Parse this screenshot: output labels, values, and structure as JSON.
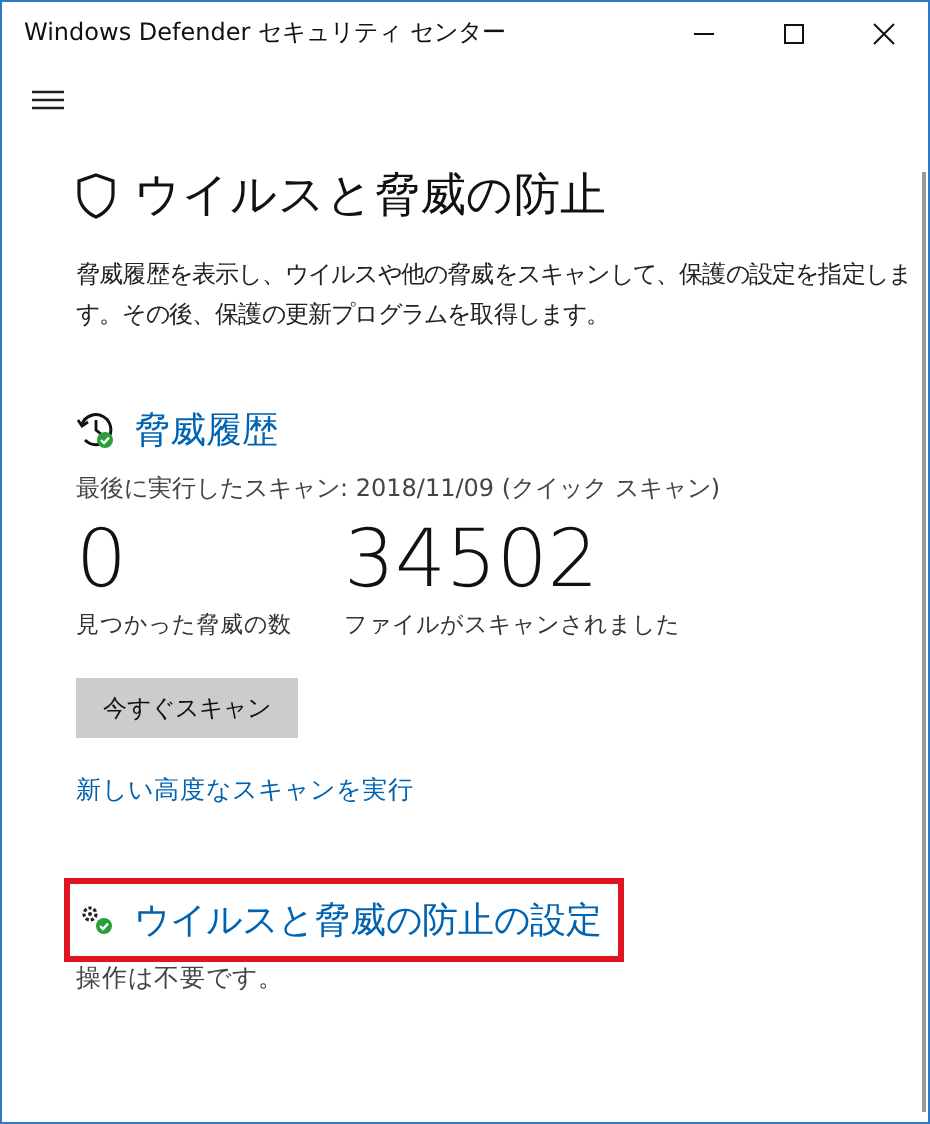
{
  "window": {
    "title": "Windows Defender セキュリティ センター"
  },
  "page": {
    "title": "ウイルスと脅威の防止",
    "description": "脅威履歴を表示し、ウイルスや他の脅威をスキャンして、保護の設定を指定します。その後、保護の更新プログラムを取得します。"
  },
  "threat_history": {
    "title": "脅威履歴",
    "last_scan": "最後に実行したスキャン: 2018/11/09 (クイック スキャン)",
    "stats": [
      {
        "value": "0",
        "label": "見つかった脅威の数"
      },
      {
        "value": "34502",
        "label": "ファイルがスキャンされました"
      }
    ],
    "scan_button": "今すぐスキャン",
    "advanced_link": "新しい高度なスキャンを実行"
  },
  "settings": {
    "title": "ウイルスと脅威の防止の設定",
    "highlighted": true,
    "status": "操作は不要です。"
  }
}
